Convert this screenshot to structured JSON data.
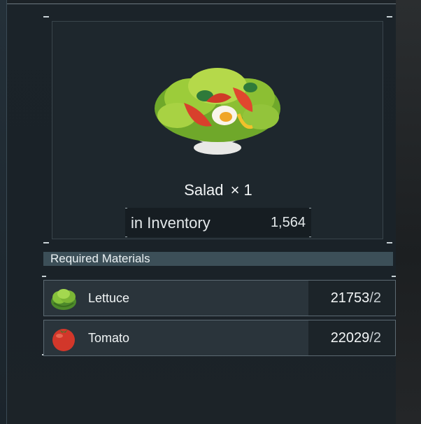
{
  "item": {
    "name": "Salad",
    "multiplier": "× 1",
    "inventory_label": "in Inventory",
    "inventory_value": "1,564",
    "icon": "salad-bowl-icon"
  },
  "materials": {
    "header": "Required Materials",
    "items": [
      {
        "name": "Lettuce",
        "owned": "21753",
        "required": "2",
        "icon": "lettuce-icon"
      },
      {
        "name": "Tomato",
        "owned": "22029",
        "required": "2",
        "icon": "tomato-icon"
      }
    ]
  },
  "colors": {
    "panel_bg": "#1b2329",
    "card_bg": "#1e272d",
    "header_bg": "#3c4f58",
    "row_bg": "#2a343b",
    "count_bg": "#1c2429"
  }
}
